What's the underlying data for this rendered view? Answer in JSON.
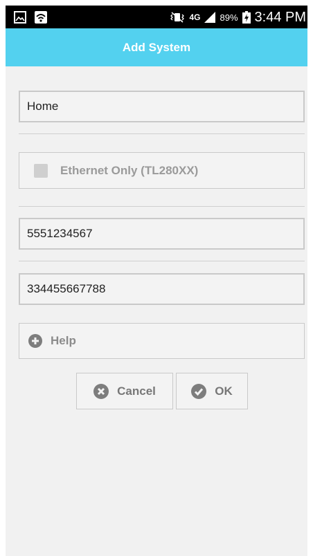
{
  "status_bar": {
    "network": "4G",
    "battery_percent": "89%",
    "time": "3:44 PM"
  },
  "action_bar": {
    "title": "Add System"
  },
  "form": {
    "name_value": "Home",
    "ethernet_only_label": "Ethernet Only (TL280XX)",
    "ethernet_only_checked": false,
    "phone_value": "5551234567",
    "mac_value": "334455667788",
    "help_label": "Help"
  },
  "buttons": {
    "cancel_label": "Cancel",
    "ok_label": "OK"
  },
  "colors": {
    "action_bar": "#53d1ef",
    "background": "#f1f1f1",
    "status_bar": "#000000"
  }
}
